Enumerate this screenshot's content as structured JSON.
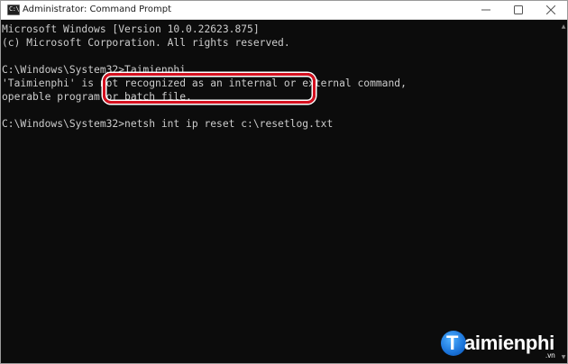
{
  "window": {
    "title": "Administrator: Command Prompt",
    "icon_label": "C:\\",
    "buttons": {
      "minimize_icon": "minimize-icon",
      "maximize_icon": "maximize-icon",
      "close_icon": "close-icon"
    }
  },
  "console": {
    "lines": [
      "Microsoft Windows [Version 10.0.22623.875]",
      "(c) Microsoft Corporation. All rights reserved.",
      "",
      "C:\\Windows\\System32>Taimienphi",
      "'Taimienphi' is not recognized as an internal or external command,",
      "operable program or batch file.",
      "",
      "C:\\Windows\\System32>netsh int ip reset c:\\resetlog.txt"
    ],
    "text_color": "#cccccc",
    "background": "#0c0c0c"
  },
  "highlight": {
    "color": "#d4101f"
  },
  "watermark": {
    "initial": "T",
    "text": "aimienphi",
    "suffix": ".vn"
  }
}
